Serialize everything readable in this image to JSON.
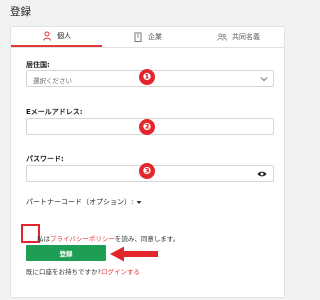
{
  "page": {
    "title": "登録"
  },
  "tabs": [
    {
      "label": "個人",
      "icon": "person-icon",
      "active": true
    },
    {
      "label": "企業",
      "icon": "building-icon",
      "active": false
    },
    {
      "label": "共同名義",
      "icon": "joint-users-icon",
      "active": false
    }
  ],
  "form": {
    "residence": {
      "label": "居住国:",
      "placeholder": "選択ください"
    },
    "email": {
      "label": "Eメールアドレス:",
      "value": ""
    },
    "password": {
      "label": "パスワード:",
      "value": ""
    },
    "partner_code": {
      "label": "パートナーコード（オプション）:"
    },
    "consent": {
      "prefix": "私は",
      "link": "プライバシーポリシー",
      "suffix": "を読み、同意します。"
    },
    "submit_label": "登録",
    "login_prompt": "既に口座をお持ちですか?",
    "login_link": "ログインする"
  },
  "annotations": {
    "step_badges": [
      "❶",
      "❷",
      "❸"
    ],
    "highlight_color": "#e3262c"
  },
  "colors": {
    "accent": "#e53935",
    "submit": "#1e9e54"
  }
}
